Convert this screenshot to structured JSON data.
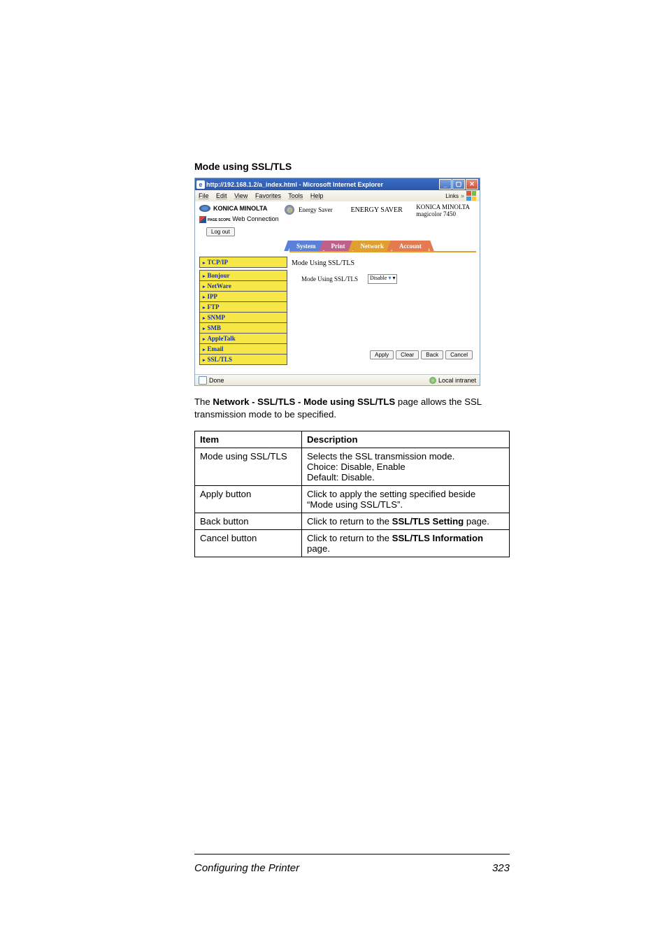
{
  "section_heading": "Mode using SSL/TLS",
  "screenshot": {
    "titlebar": "http://192.168.1.2/a_index.html - Microsoft Internet Explorer",
    "menu": {
      "items": [
        "File",
        "Edit",
        "View",
        "Favorites",
        "Tools",
        "Help"
      ],
      "links": "Links"
    },
    "brand": "KONICA MINOLTA",
    "pagescope": "PAGE SCOPE",
    "webconn": " Web Connection",
    "energy_label": "Energy Saver",
    "energy_big": "ENERGY SAVER",
    "device_brand": "KONICA MINOLTA",
    "device_model": "magicolor 7450",
    "logout": "Log out",
    "tabs": {
      "system": "System",
      "print": "Print",
      "network": "Network",
      "account": "Account"
    },
    "sidebar": [
      "TCP/IP",
      "Bonjour",
      "NetWare",
      "IPP",
      "FTP",
      "SNMP",
      "SMB",
      "AppleTalk",
      "Email",
      "SSL/TLS"
    ],
    "pane_title": "Mode Using SSL/TLS",
    "pane_field": "Mode Using SSL/TLS",
    "pane_value": "Disable",
    "buttons": {
      "apply": "Apply",
      "clear": "Clear",
      "back": "Back",
      "cancel": "Cancel"
    },
    "status_done": "Done",
    "status_zone": "Local intranet"
  },
  "para_pre": "The ",
  "para_bold": "Network - SSL/TLS - Mode using SSL/TLS",
  "para_post": " page allows the SSL transmission mode to be specified.",
  "table": {
    "h1": "Item",
    "h2": "Description",
    "rows": [
      {
        "item": "Mode using SSL/TLS",
        "desc": "Selects the SSL transmission mode.\nChoice:  Disable, Enable\nDefault:  Disable."
      },
      {
        "item": "Apply button",
        "desc_pre": "Click to apply the setting specified beside “Mode using SSL/TLS”."
      },
      {
        "item": "Back button",
        "desc_pre": "Click to return to the ",
        "desc_bold": "SSL/TLS Setting",
        "desc_post": " page."
      },
      {
        "item": "Cancel button",
        "desc_pre": "Click to return to the ",
        "desc_bold": "SSL/TLS Information",
        "desc_post": " page."
      }
    ]
  },
  "footer_left": "Configuring the Printer",
  "footer_right": "323"
}
